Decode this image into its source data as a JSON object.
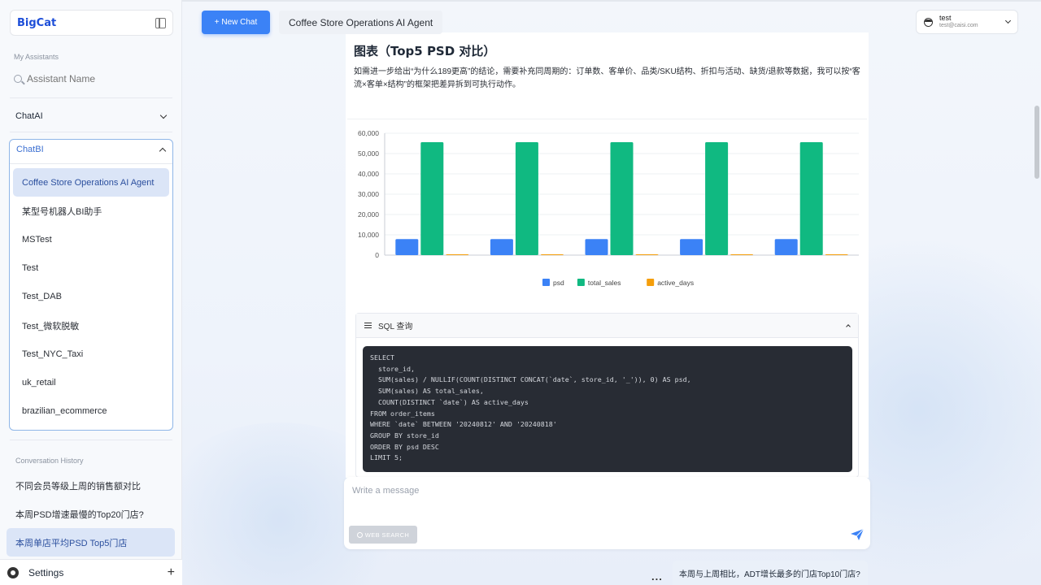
{
  "sidebar": {
    "brand": "BigCat",
    "my_assistants_label": "My Assistants",
    "search_placeholder": "Assistant Name",
    "groups": [
      {
        "label": "ChatAI",
        "expanded": false
      },
      {
        "label": "ChatBI",
        "expanded": true
      }
    ],
    "assistants": [
      "Coffee Store Operations AI Agent",
      "某型号机器人BI助手",
      "MSTest",
      "Test",
      "Test_DAB",
      "Test_微软脱敏",
      "Test_NYC_Taxi",
      "uk_retail",
      "brazilian_ecommerce"
    ],
    "active_assistant": 0,
    "history_label": "Conversation History",
    "history": [
      "不同会员等级上周的销售额对比",
      "本周PSD增速最慢的Top20门店?",
      "本周单店平均PSD Top5门店"
    ],
    "active_history": 2,
    "settings_label": "Settings"
  },
  "header": {
    "new_chat_label": "+ New Chat",
    "agent_title": "Coffee Store Operations AI Agent",
    "user": {
      "name": "test",
      "email": "test@caisi.com"
    }
  },
  "message": {
    "heading": "图表（Top5 PSD 对比）",
    "paragraph": "如需进一步给出“为什么189更高”的结论，需要补充同周期的：订单数、客单价、品类/SKU结构、折扣与活动、缺货/退款等数据，我可以按“客流×客单×结构”的框架把差异拆到可执行动作。",
    "sql_title": "SQL 查询",
    "sql_code": "SELECT\n  store_id,\n  SUM(sales) / NULLIF(COUNT(DISTINCT CONCAT(`date`, store_id, '_')), 0) AS psd,\n  SUM(sales) AS total_sales,\n  COUNT(DISTINCT `date`) AS active_days\nFROM order_items\nWHERE `date` BETWEEN '20240812' AND '20240818'\nGROUP BY store_id\nORDER BY psd DESC\nLIMIT 5;"
  },
  "chart_data": {
    "type": "bar",
    "categories": [
      "",
      "",
      "",
      "",
      ""
    ],
    "series": [
      {
        "name": "psd",
        "color": "#3b82f6",
        "values": [
          7900,
          7900,
          7900,
          7900,
          7900
        ]
      },
      {
        "name": "total_sales",
        "color": "#10b981",
        "values": [
          55600,
          55600,
          55600,
          55600,
          55600
        ]
      },
      {
        "name": "active_days",
        "color": "#f59e0b",
        "values": [
          7,
          7,
          7,
          7,
          7
        ]
      }
    ],
    "yticks": [
      "0",
      "10,000",
      "20,000",
      "30,000",
      "40,000",
      "50,000",
      "60,000"
    ],
    "ylim": [
      0,
      60000
    ],
    "grid": true,
    "legend_position": "bottom-center"
  },
  "composer": {
    "placeholder": "Write a message",
    "web_search_label": "WEB SEARCH"
  },
  "suggestion": {
    "more_label": "...",
    "text": "本周与上周相比，ADT增长最多的门店Top10门店?"
  },
  "colors": {
    "accent": "#3b82f6",
    "active_bg": "#dbe5f7",
    "code_bg": "#282c34"
  }
}
